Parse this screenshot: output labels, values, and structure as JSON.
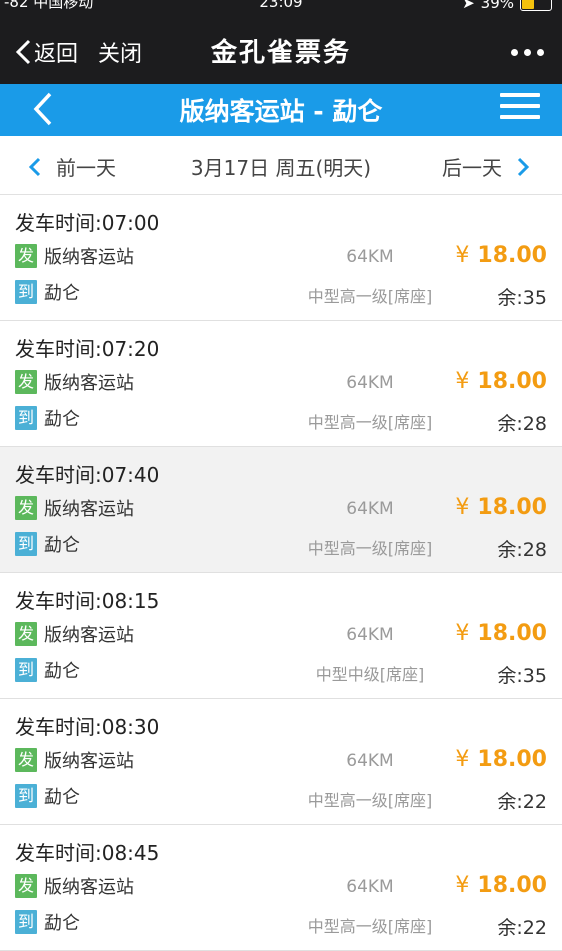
{
  "status_bar": {
    "carrier": "-82 中国移动",
    "time": "23:09",
    "battery": "39%",
    "battery_level": 0.39
  },
  "wechat_bar": {
    "back_label": "返回",
    "close_label": "关闭",
    "title": "金孔雀票务"
  },
  "header": {
    "route": "版纳客运站 - 勐仑"
  },
  "date_nav": {
    "prev_label": "前一天",
    "current_date": "3月17日 周五(明天)",
    "next_label": "后一天"
  },
  "tags": {
    "depart": "发",
    "arrive": "到"
  },
  "trips": [
    {
      "depart_time": "发车时间:07:00",
      "from": "版纳客运站",
      "to": "勐仑",
      "distance": "64KM",
      "bus_type": "中型高一级[席座]",
      "currency": "¥",
      "price": "18.00",
      "seats": "余:35"
    },
    {
      "depart_time": "发车时间:07:20",
      "from": "版纳客运站",
      "to": "勐仑",
      "distance": "64KM",
      "bus_type": "中型高一级[席座]",
      "currency": "¥",
      "price": "18.00",
      "seats": "余:28"
    },
    {
      "depart_time": "发车时间:07:40",
      "from": "版纳客运站",
      "to": "勐仑",
      "distance": "64KM",
      "bus_type": "中型高一级[席座]",
      "currency": "¥",
      "price": "18.00",
      "seats": "余:28"
    },
    {
      "depart_time": "发车时间:08:15",
      "from": "版纳客运站",
      "to": "勐仑",
      "distance": "64KM",
      "bus_type": "中型中级[席座]",
      "currency": "¥",
      "price": "18.00",
      "seats": "余:35"
    },
    {
      "depart_time": "发车时间:08:30",
      "from": "版纳客运站",
      "to": "勐仑",
      "distance": "64KM",
      "bus_type": "中型高一级[席座]",
      "currency": "¥",
      "price": "18.00",
      "seats": "余:22"
    },
    {
      "depart_time": "发车时间:08:45",
      "from": "版纳客运站",
      "to": "勐仑",
      "distance": "64KM",
      "bus_type": "中型高一级[席座]",
      "currency": "¥",
      "price": "18.00",
      "seats": "余:22"
    }
  ],
  "colors": {
    "header_blue": "#1a9be8",
    "price_orange": "#f39c12",
    "depart_tag_green": "#5cb85c",
    "arrive_tag_blue": "#4bb0d6"
  }
}
